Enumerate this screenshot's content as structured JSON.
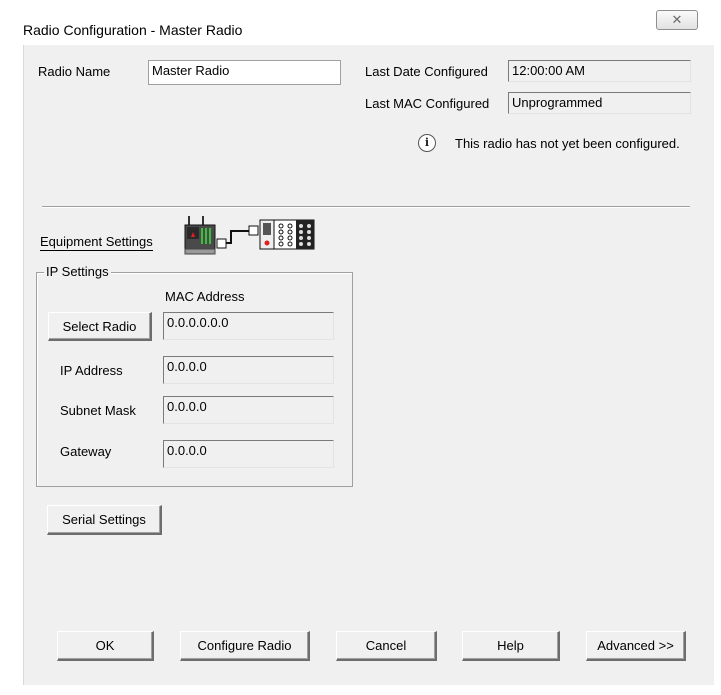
{
  "window": {
    "title": "Radio Configuration - Master Radio",
    "close_glyph": "✕"
  },
  "radio_name": {
    "label": "Radio Name",
    "value": "Master Radio"
  },
  "last_date": {
    "label": "Last Date Configured",
    "value": "12:00:00 AM"
  },
  "last_mac": {
    "label": "Last MAC Configured",
    "value": "Unprogrammed"
  },
  "status_message": "This radio has not yet been configured.",
  "equipment": {
    "label": "Equipment Settings",
    "icon": "equipment-radio-icon"
  },
  "ip_settings": {
    "legend": "IP Settings",
    "mac_header": "MAC Address",
    "select_radio_label": "Select Radio",
    "mac_value": "0.0.0.0.0.0",
    "ip_label": "IP Address",
    "ip_value": "0.0.0.0",
    "subnet_label": "Subnet Mask",
    "subnet_value": "0.0.0.0",
    "gateway_label": "Gateway",
    "gateway_value": "0.0.0.0"
  },
  "serial_settings_label": "Serial Settings",
  "buttons": {
    "ok": "OK",
    "configure": "Configure Radio",
    "cancel": "Cancel",
    "help": "Help",
    "advanced": "Advanced >>"
  },
  "colors": {
    "dialog_bg": "#f0f0f0",
    "window_frame": "#ffffff"
  }
}
